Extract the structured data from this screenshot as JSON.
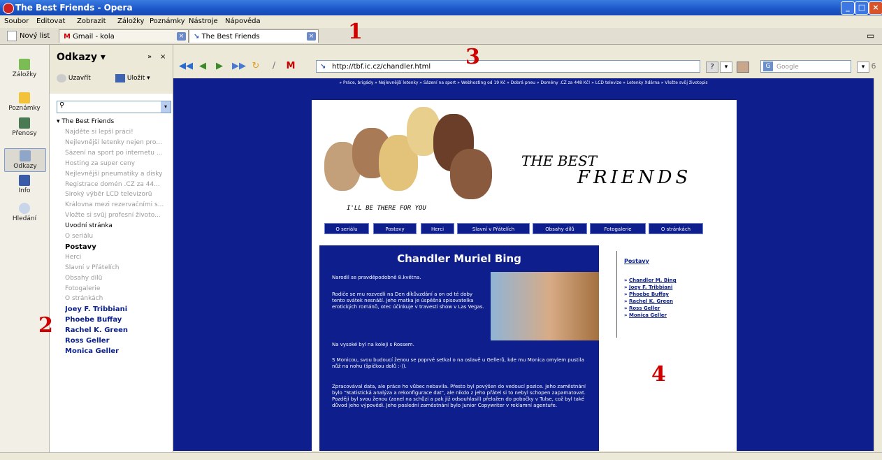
{
  "window": {
    "title": "The Best Friends - Opera"
  },
  "menu": [
    "Soubor",
    "Editovat",
    "Zobrazit",
    "Záložky",
    "Poznámky",
    "Nástroje",
    "Nápověda"
  ],
  "tabs": {
    "new_tab": "Nový list",
    "items": [
      {
        "label": "Gmail - kola"
      },
      {
        "label": "The Best Friends"
      }
    ]
  },
  "left_panel": {
    "items": [
      {
        "label": "Záložky",
        "icon": "bookmarks-icon"
      },
      {
        "label": "Poznámky",
        "icon": "notes-icon"
      },
      {
        "label": "Přenosy",
        "icon": "transfers-icon"
      },
      {
        "label": "Odkazy",
        "icon": "links-icon"
      },
      {
        "label": "Info",
        "icon": "info-icon"
      },
      {
        "label": "Hledání",
        "icon": "search-icon"
      }
    ]
  },
  "links_panel": {
    "title": "Odkazy",
    "close_button": "Uzavřít",
    "save_button": "Uložit",
    "tree_root": "The Best Friends",
    "links": [
      {
        "text": "Najděte si lepší práci!",
        "style": "gray"
      },
      {
        "text": "Nejlevnější letenky nejen pro...",
        "style": "gray"
      },
      {
        "text": "Sázení na sport po internetu ...",
        "style": "gray"
      },
      {
        "text": "Hosting za super ceny",
        "style": "gray"
      },
      {
        "text": "Nejlevnější pneumatiky a disky",
        "style": "gray"
      },
      {
        "text": "Registrace domén .CZ za 44...",
        "style": "gray"
      },
      {
        "text": "Široký výběr LCD televizorů",
        "style": "gray"
      },
      {
        "text": "Královna mezi rezervačními s...",
        "style": "gray"
      },
      {
        "text": "Vložte si svůj profesní životo...",
        "style": "gray"
      },
      {
        "text": "Úvodní stránka",
        "style": "dark"
      },
      {
        "text": "O seriálu",
        "style": "gray"
      },
      {
        "text": "Postavy",
        "style": "bold"
      },
      {
        "text": "Herci",
        "style": "gray"
      },
      {
        "text": "Slavní v Přátelích",
        "style": "gray"
      },
      {
        "text": "Obsahy dílů",
        "style": "gray"
      },
      {
        "text": "Fotogalerie",
        "style": "gray"
      },
      {
        "text": "O stránkách",
        "style": "gray"
      },
      {
        "text": "Joey F. Tribbiani",
        "style": "blue"
      },
      {
        "text": "Phoebe Buffay",
        "style": "blue"
      },
      {
        "text": "Rachel K. Green",
        "style": "blue"
      },
      {
        "text": "Ross Geller",
        "style": "blue"
      },
      {
        "text": "Monica Geller",
        "style": "blue"
      }
    ]
  },
  "toolbar": {
    "address": "http://tbf.ic.cz/chandler.html",
    "search_placeholder": "Google"
  },
  "page": {
    "ads_line": "» Práce, brigády  » Nejlevnější letenky  » Sázení na sport  » Webhosting od 19 Kč  » Dobrá pneu  » Domény .CZ za 448 Kč!  » LCD televize  » Letenky Xdárna  » Vložte svůj životopis",
    "logo_line1": "THE BEST",
    "logo_line2": "FRIENDS",
    "tagline": "I'LL BE THERE FOR YOU",
    "nav": [
      "O seriálu",
      "Postavy",
      "Herci",
      "Slavní v Přátelích",
      "Obsahy dílů",
      "Fotogalerie",
      "O stránkách"
    ],
    "heading": "Chandler Muriel Bing",
    "paragraphs": [
      "Narodil se pravděpodobně 8.května.",
      "Rodiče se mu rozvedli na Den díkůvzdání a on od té doby tento svátek nesnáší. Jeho matka je úspěšná spisovatelka erotických románů, otec účinkuje v travesti show v Las Vegas.",
      "Na vysoké byl na koleji s Rossem.",
      "S Monicou, svou budoucí ženou se poprvé setkal o na oslavě u Gellerů, kde mu Monica omylem pustila nůž na nohu (špičkou dolů :-)).",
      "Zpracovával data, ale práce ho vůbec nebavila. Přesto byl povýšen do vedoucí pozice. Jeho zaměstnání bylo \"Statistická analýza a rekonfigurace dat\", ale nikdo z jeho přátel si to nebyl schopen zapamatovat. Později byl svou ženou (zanel na schůzi a pak již odsouhlasil) přeložen do pobočky v Tulse, což byl také důvod jeho výpovědi. Jeho poslední zaměstnání bylo Junior Copywriter v reklamní agentuře."
    ],
    "sidebar_title": "Postavy",
    "sidebar_links": [
      "Chandler M. Bing",
      "Joey F. Tribbiani",
      "Phoebe Buffay",
      "Rachel K. Green",
      "Ross Geller",
      "Monica Geller"
    ]
  },
  "markers": [
    "1",
    "2",
    "3",
    "4"
  ],
  "colors": {
    "page_bg": "#0e1e8c",
    "marker": "#d00000",
    "titlebar": "#1b56c9"
  }
}
